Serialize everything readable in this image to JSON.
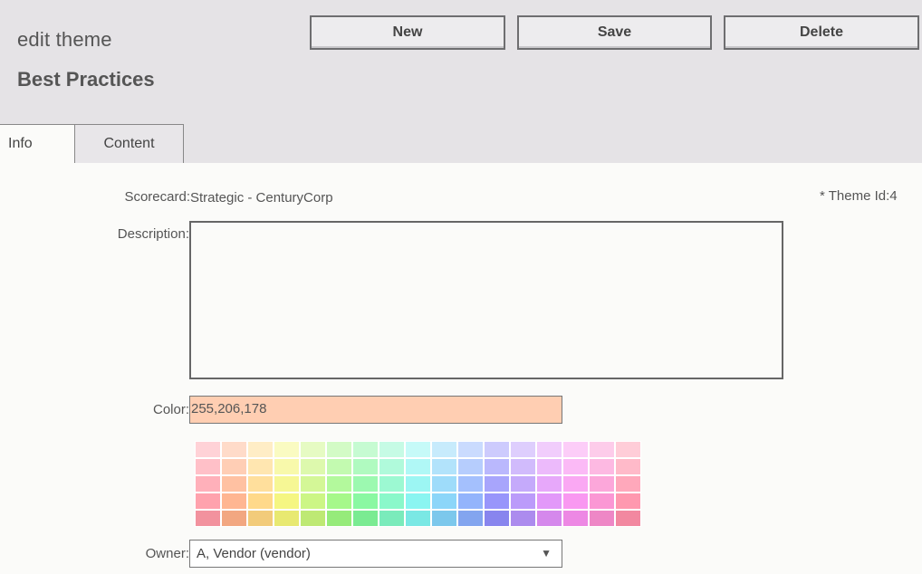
{
  "header": {
    "title": "edit theme",
    "subtitle": "Best Practices",
    "buttons": {
      "new": "New",
      "save": "Save",
      "delete": "Delete"
    }
  },
  "tabs": [
    {
      "label": "Info",
      "active": true
    },
    {
      "label": "Content",
      "active": false
    }
  ],
  "form": {
    "scorecard_label": "Scorecard:",
    "scorecard_value": "Strategic - CenturyCorp",
    "theme_id": "* Theme Id:4",
    "description_label": "Description:",
    "description_value": "",
    "color_label": "Color:",
    "color_value": "255,206,178",
    "owner_label": "Owner:",
    "owner_value": "A, Vendor (vendor)",
    "owner_arrow": "▼"
  },
  "palette": {
    "rows": 5,
    "columns": 17,
    "hues": [
      "#ff9aa6",
      "#ffb088",
      "#ffd680",
      "#f4f577",
      "#c8f57a",
      "#9ef780",
      "#80f79a",
      "#80f7c5",
      "#80f4f0",
      "#82d2f8",
      "#8aaefc",
      "#8f8cfb",
      "#b592fa",
      "#e08ff8",
      "#f98ff0",
      "#fb8ed0",
      "#ff8fa8"
    ],
    "selected": "#ffceb2"
  }
}
